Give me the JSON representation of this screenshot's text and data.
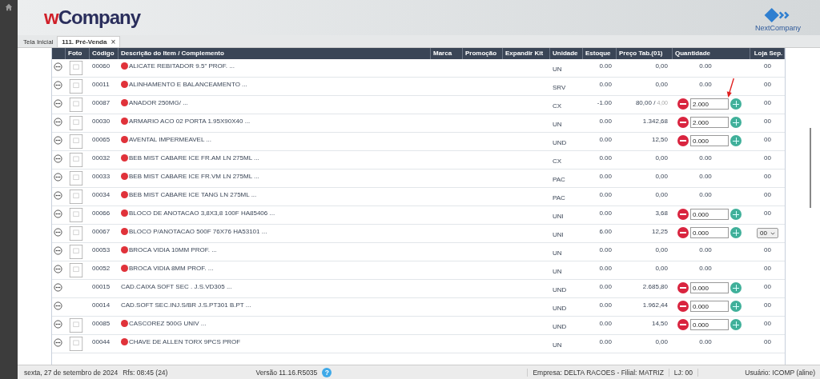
{
  "header": {
    "logo_prefix": "w",
    "logo_name": "Company",
    "partner_logo": "NextCompany"
  },
  "tabs": [
    {
      "label": "Tela Inicial",
      "selected": false,
      "closable": false
    },
    {
      "label": "111. Pré-Venda",
      "selected": true,
      "closable": true
    }
  ],
  "close_glyph": "×",
  "table": {
    "columns": [
      "Foto",
      "Código",
      "Descrição do Item / Complemento",
      "Marca",
      "Promoção",
      "Expandir Kit",
      "Unidade",
      "Estoque",
      "Preço Tab.(01)",
      "Quantidade",
      "Loja Sep."
    ],
    "rows": [
      {
        "photo": true,
        "code": "00060",
        "marked": true,
        "description": "ALICATE REBITADOR 9.5\" PROF. ...",
        "unit": "UN",
        "stock": "0.00",
        "price": "0,00",
        "kind": "text",
        "quantity": "0.00",
        "store": {
          "kind": "text",
          "value": "00"
        }
      },
      {
        "photo": true,
        "code": "00011",
        "marked": true,
        "description": "ALINHAMENTO E BALANCEAMENTO ...",
        "unit": "SRV",
        "stock": "0.00",
        "price": "0,00",
        "kind": "text",
        "quantity": "0.00",
        "store": {
          "kind": "text",
          "value": "00"
        }
      },
      {
        "photo": true,
        "code": "00087",
        "marked": true,
        "description": "ANADOR 250MG/ ...",
        "unit": "CX",
        "stock": "-1.00",
        "price": "80,00 /",
        "price_alt": "4,00",
        "kind": "stepper",
        "quantity": "2.000",
        "store": {
          "kind": "text",
          "value": "00"
        }
      },
      {
        "photo": true,
        "code": "00030",
        "marked": true,
        "description": "ARMARIO ACO 02 PORTA 1.95X90X40 ...",
        "unit": "UN",
        "stock": "0.00",
        "price": "1.342,68",
        "kind": "stepper",
        "quantity": "2.000",
        "store": {
          "kind": "text",
          "value": "00"
        }
      },
      {
        "photo": true,
        "code": "00065",
        "marked": true,
        "description": "AVENTAL IMPERMEAVEL ...",
        "unit": "UND",
        "stock": "0.00",
        "price": "12,50",
        "kind": "stepper",
        "quantity": "0.000",
        "store": {
          "kind": "text",
          "value": "00"
        }
      },
      {
        "photo": true,
        "code": "00032",
        "marked": true,
        "description": "BEB MIST CABARE ICE FR.AM LN 275ML ...",
        "unit": "CX",
        "stock": "0.00",
        "price": "0,00",
        "kind": "text",
        "quantity": "0.00",
        "store": {
          "kind": "text",
          "value": "00"
        }
      },
      {
        "photo": true,
        "code": "00033",
        "marked": true,
        "description": "BEB MIST CABARE ICE FR.VM LN 275ML ...",
        "unit": "PAC",
        "stock": "0.00",
        "price": "0,00",
        "kind": "text",
        "quantity": "0.00",
        "store": {
          "kind": "text",
          "value": "00"
        }
      },
      {
        "photo": true,
        "code": "00034",
        "marked": true,
        "description": "BEB MIST CABARE ICE TANG LN 275ML ...",
        "unit": "PAC",
        "stock": "0.00",
        "price": "0,00",
        "kind": "text",
        "quantity": "0.00",
        "store": {
          "kind": "text",
          "value": "00"
        }
      },
      {
        "photo": true,
        "code": "00066",
        "marked": true,
        "description": "BLOCO DE ANOTACAO 3,8X3,8 100F HA85406 ...",
        "unit": "UNI",
        "stock": "0.00",
        "price": "3,68",
        "kind": "stepper",
        "quantity": "0.000",
        "store": {
          "kind": "text",
          "value": "00"
        }
      },
      {
        "photo": true,
        "code": "00067",
        "marked": true,
        "description": "BLOCO P/ANOTACAO 500F 76X76 HA53101 ...",
        "unit": "UNI",
        "stock": "6.00",
        "price": "12,25",
        "kind": "stepper",
        "quantity": "0.000",
        "store": {
          "kind": "select",
          "value": "00"
        }
      },
      {
        "photo": true,
        "code": "00053",
        "marked": true,
        "description": "BROCA VIDIA 10MM PROF. ...",
        "unit": "UN",
        "stock": "0.00",
        "price": "0,00",
        "kind": "text",
        "quantity": "0.00",
        "store": {
          "kind": "text",
          "value": "00"
        }
      },
      {
        "photo": true,
        "code": "00052",
        "marked": true,
        "description": "BROCA VIDIA 8MM PROF. ...",
        "unit": "UN",
        "stock": "0.00",
        "price": "0,00",
        "kind": "text",
        "quantity": "0.00",
        "store": {
          "kind": "text",
          "value": "00"
        }
      },
      {
        "photo": false,
        "code": "00015",
        "marked": false,
        "description": "CAD.CAIXA SOFT SEC . J.S.VD305 ...",
        "unit": "UND",
        "stock": "0.00",
        "price": "2.685,80",
        "kind": "stepper",
        "quantity": "0.000",
        "store": {
          "kind": "text",
          "value": "00"
        }
      },
      {
        "photo": false,
        "code": "00014",
        "marked": false,
        "description": "CAD.SOFT SEC.INJ.S/BR J.S.PT301 B.PT ...",
        "unit": "UND",
        "stock": "0.00",
        "price": "1.962,44",
        "kind": "stepper",
        "quantity": "0.000",
        "store": {
          "kind": "text",
          "value": "00"
        }
      },
      {
        "photo": true,
        "code": "00085",
        "marked": true,
        "description": "CASCOREZ 500G UNIV ...",
        "unit": "UND",
        "stock": "0.00",
        "price": "14,50",
        "kind": "stepper",
        "quantity": "0.000",
        "store": {
          "kind": "text",
          "value": "00"
        }
      },
      {
        "photo": true,
        "code": "00044",
        "marked": true,
        "description": "CHAVE DE ALLEN TORX 9PCS PROF",
        "unit": "UN",
        "stock": "0.00",
        "price": "0,00",
        "kind": "text",
        "quantity": "0.00",
        "store": {
          "kind": "text",
          "value": "00"
        }
      }
    ]
  },
  "status_bar": {
    "date": "sexta, 27 de setembro de 2024",
    "refresh": "Rfs: 08:45 (24)",
    "version": "Versão 11.16.R5035",
    "help": "?",
    "company": "Empresa: DELTA RACOES - Filial: MATRIZ",
    "store": "LJ: 00",
    "user": "Usuário: ICOMP (aline)"
  }
}
